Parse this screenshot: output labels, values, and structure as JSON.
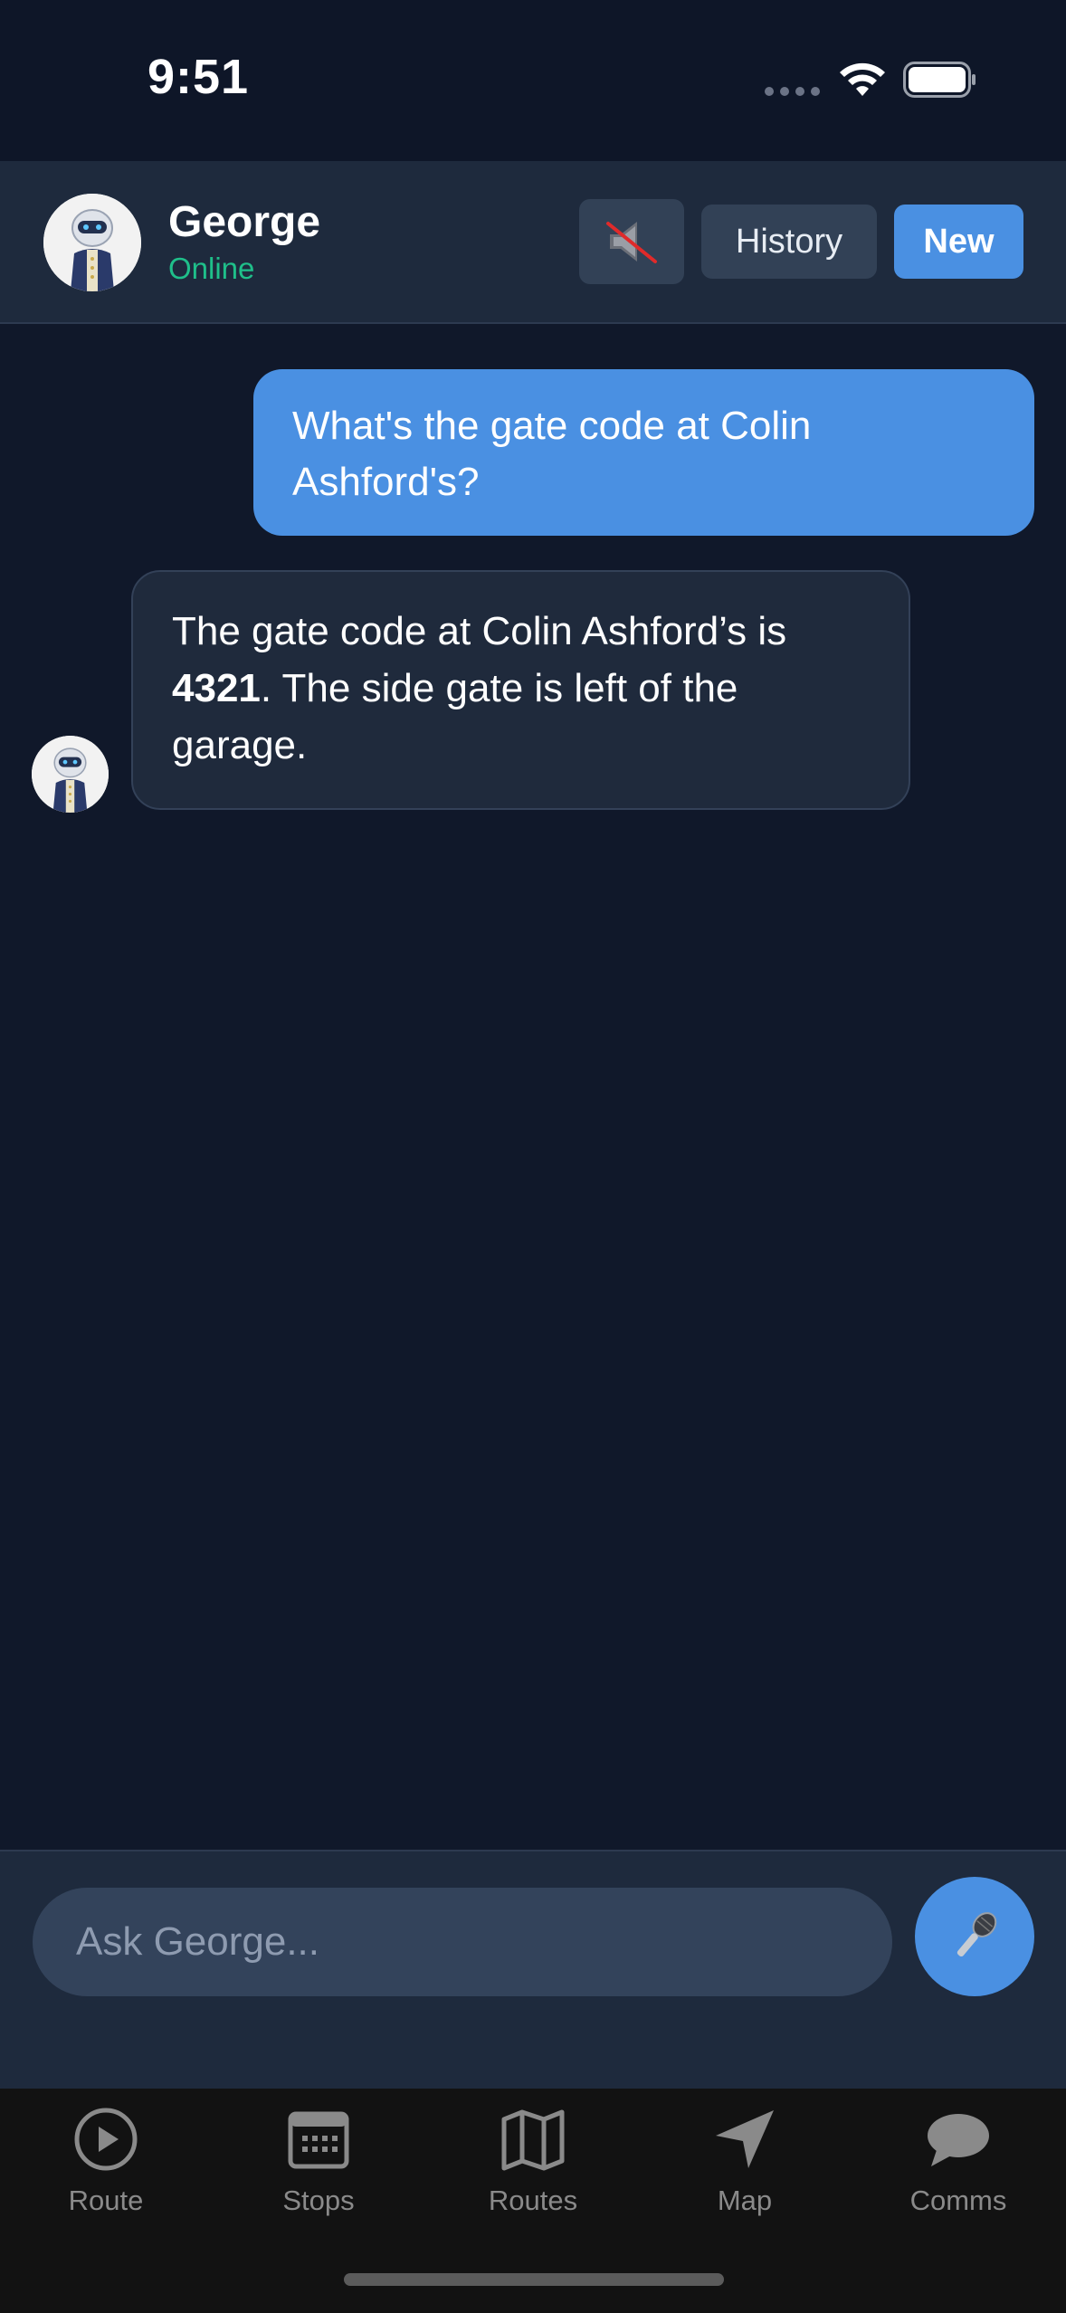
{
  "status_bar": {
    "time": "9:51"
  },
  "header": {
    "contact_name": "George",
    "contact_status": "Online",
    "mute_icon": "speaker-muted-icon",
    "history_label": "History",
    "new_label": "New"
  },
  "messages": [
    {
      "sender": "user",
      "text": "What's the gate code at Colin Ashford's?"
    },
    {
      "sender": "bot",
      "text_before": "The gate code at Colin Ashford’s is ",
      "text_bold": "4321",
      "text_after": ". The side gate is left of the garage."
    }
  ],
  "composer": {
    "placeholder": "Ask George...",
    "value": "",
    "mic_icon": "microphone-icon"
  },
  "tabs": [
    {
      "label": "Route",
      "icon": "play-circle-icon"
    },
    {
      "label": "Stops",
      "icon": "calendar-icon"
    },
    {
      "label": "Routes",
      "icon": "map-icon"
    },
    {
      "label": "Map",
      "icon": "navigation-arrow-icon"
    },
    {
      "label": "Comms",
      "icon": "chat-bubble-icon"
    }
  ],
  "colors": {
    "background": "#10182a",
    "header": "#1e2a3d",
    "accent": "#4a90e2",
    "online": "#1fbf8a",
    "bot_bubble": "#1f2a3c",
    "tabbar": "#121212"
  }
}
